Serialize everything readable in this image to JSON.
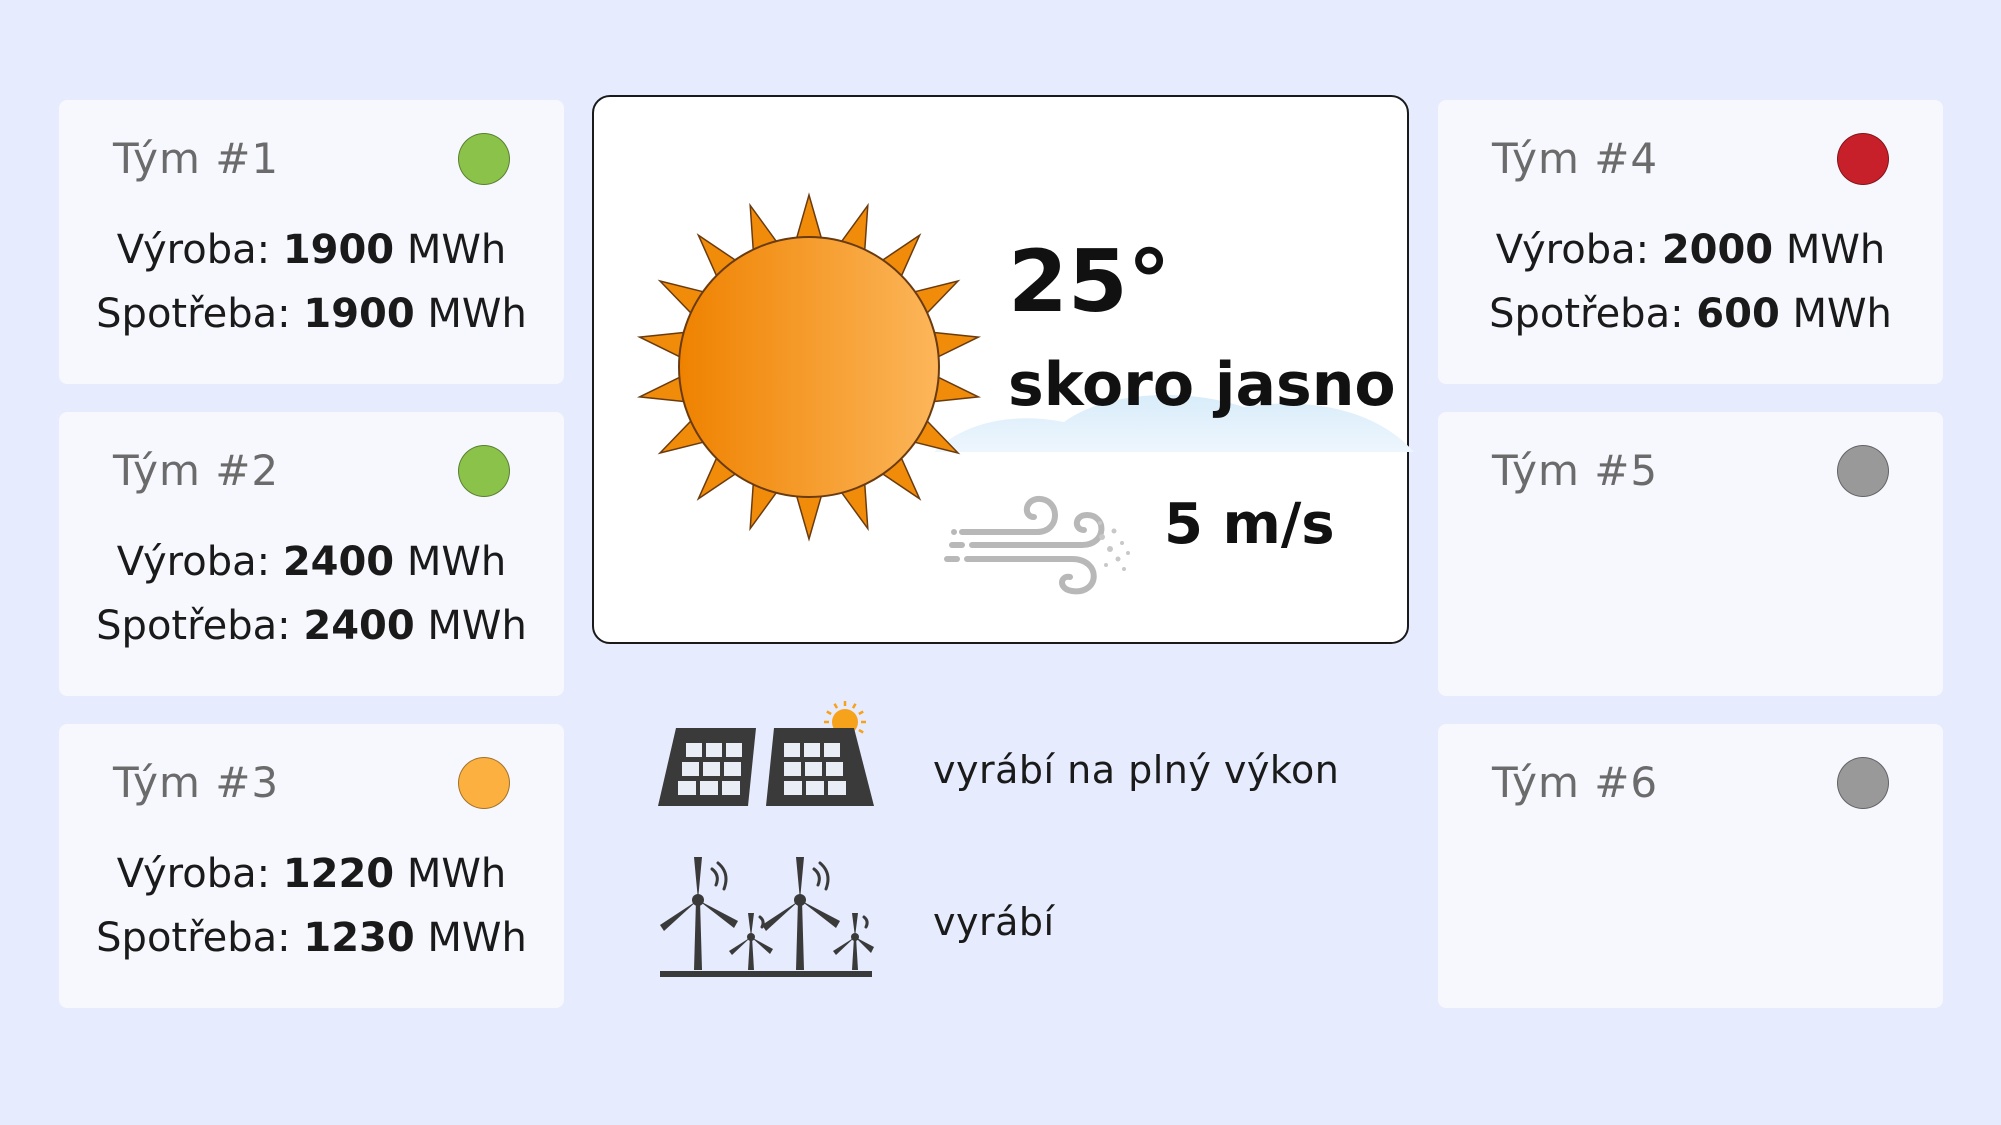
{
  "teams": [
    {
      "name": "Tým #1",
      "status_color": "#8bc34a",
      "production_label": "Výroba: ",
      "production_value": "1900",
      "production_unit": " MWh",
      "consumption_label": "Spotřeba: ",
      "consumption_value": "1900",
      "consumption_unit": " MWh"
    },
    {
      "name": "Tým #2",
      "status_color": "#8bc34a",
      "production_label": "Výroba: ",
      "production_value": "2400",
      "production_unit": " MWh",
      "consumption_label": "Spotřeba: ",
      "consumption_value": "2400",
      "consumption_unit": " MWh"
    },
    {
      "name": "Tým #3",
      "status_color": "#fbb040",
      "production_label": "Výroba: ",
      "production_value": "1220",
      "production_unit": " MWh",
      "consumption_label": "Spotřeba: ",
      "consumption_value": "1230",
      "consumption_unit": " MWh"
    },
    {
      "name": "Tým #4",
      "status_color": "#c8202a",
      "production_label": "Výroba: ",
      "production_value": "2000",
      "production_unit": " MWh",
      "consumption_label": "Spotřeba: ",
      "consumption_value": "600",
      "consumption_unit": " MWh"
    },
    {
      "name": "Tým #5",
      "status_color": "#999999"
    },
    {
      "name": "Tým #6",
      "status_color": "#999999"
    }
  ],
  "weather": {
    "icon": "sun-icon",
    "temperature": "25°",
    "condition": "skoro jasno",
    "wind_icon": "wind-icon",
    "wind_speed": "5 m/s"
  },
  "sources": {
    "solar": {
      "icon": "solar-panel-icon",
      "status": "vyrábí na plný výkon"
    },
    "wind": {
      "icon": "wind-turbine-icon",
      "status": "vyrábí"
    }
  }
}
